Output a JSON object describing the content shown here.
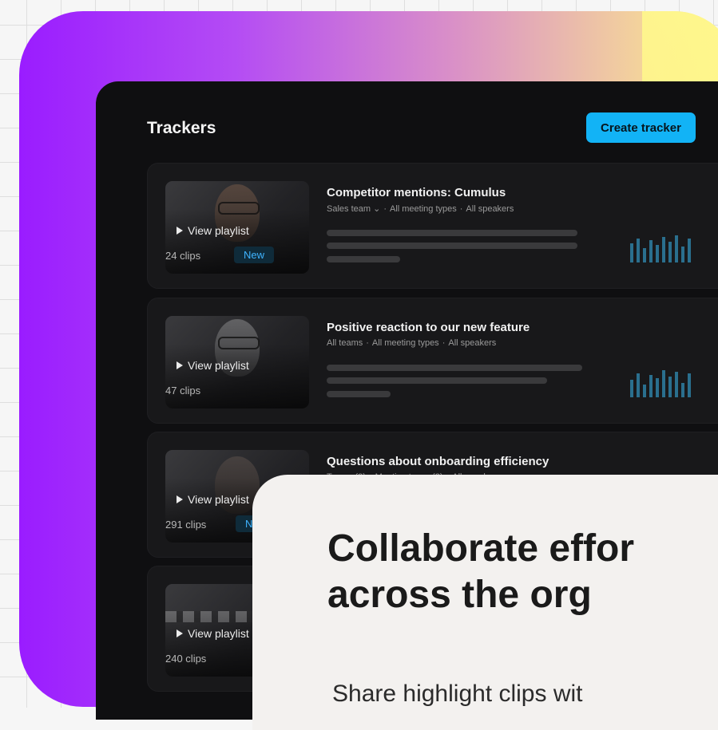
{
  "header": {
    "title": "Trackers",
    "create_button_label": "Create tracker"
  },
  "trackers": [
    {
      "title": "Competitor mentions: Cumulus",
      "meta": [
        "Sales team ⌄",
        "·",
        "All meeting types",
        "·",
        "All speakers"
      ],
      "view_label": "View playlist",
      "clips": "24 clips",
      "badge": "New"
    },
    {
      "title": "Positive reaction to our new feature",
      "meta": [
        "All teams",
        "·",
        "All meeting types",
        "·",
        "All speakers"
      ],
      "view_label": "View playlist",
      "clips": "47 clips",
      "badge": ""
    },
    {
      "title": "Questions about onboarding efficiency",
      "meta": [
        "Teams (3)",
        "·",
        "Meeting types (2)",
        "·",
        "All speakers"
      ],
      "view_label": "View playlist",
      "clips": "291 clips",
      "badge": "New"
    },
    {
      "title": "",
      "meta": [],
      "view_label": "View playlist",
      "clips": "240 clips",
      "badge": ""
    }
  ],
  "overlay": {
    "headline_line1": "Collaborate effor",
    "headline_line2": "across the org",
    "subtext": "Share highlight clips wit"
  },
  "colors": {
    "accent": "#12b3f6",
    "badge_text": "#3fb4ff",
    "gradient_start": "#9a1cff",
    "gradient_end": "#fff58a"
  }
}
